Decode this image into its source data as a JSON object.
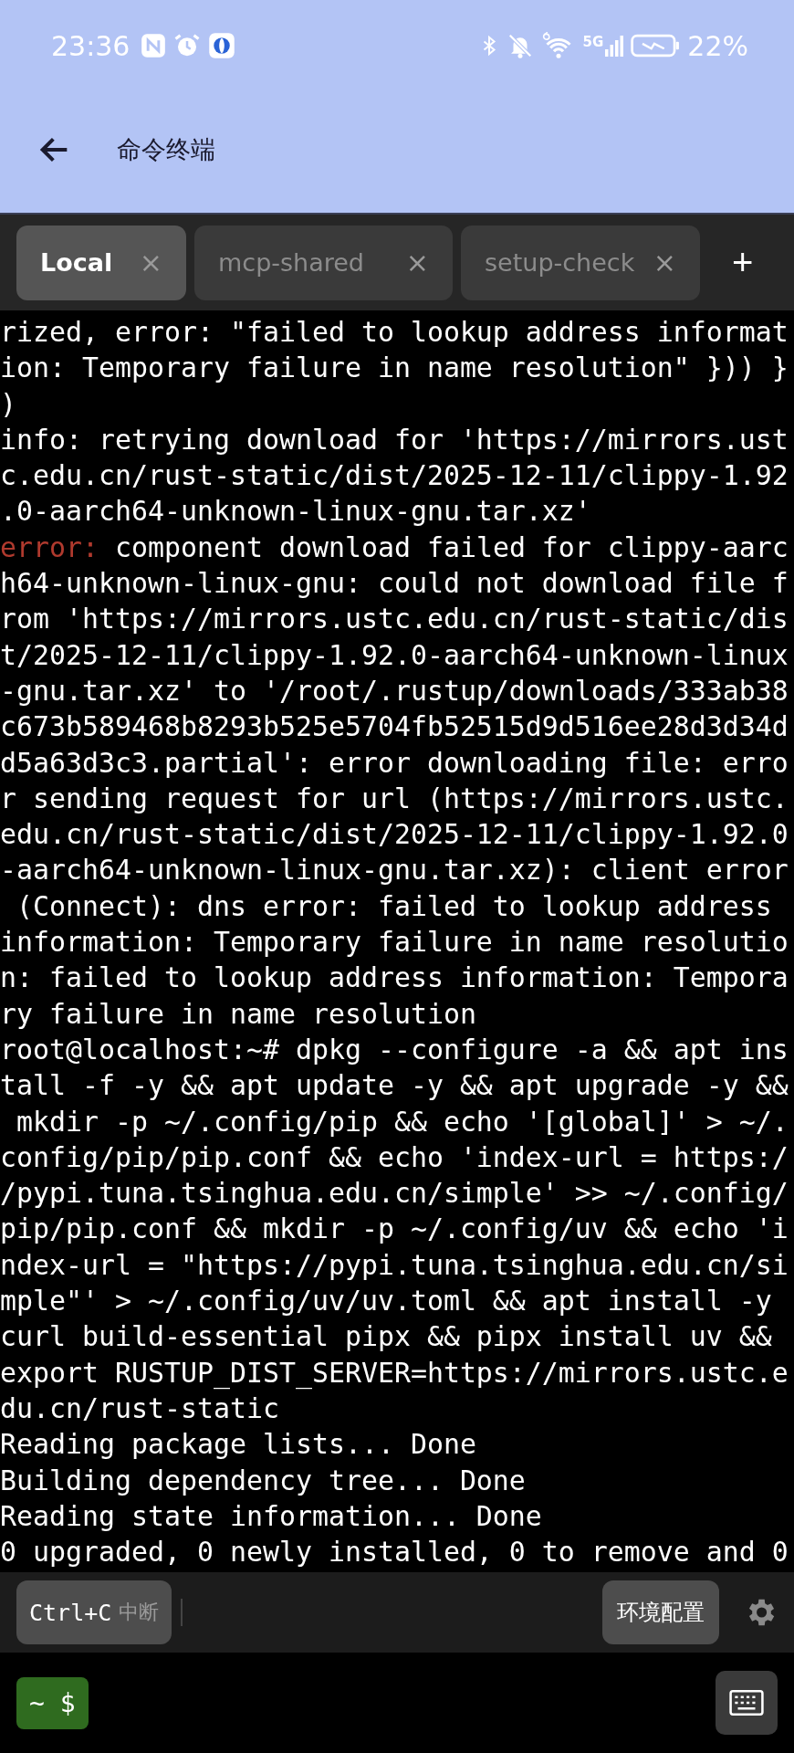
{
  "status_bar": {
    "time": "23:36",
    "network": "5G",
    "battery": "22%"
  },
  "app_bar": {
    "title": "命令终端"
  },
  "tabs": [
    {
      "label": "Local",
      "selected": true,
      "close": "×"
    },
    {
      "label": "mcp-shared",
      "selected": false,
      "close": "×"
    },
    {
      "label": "setup-check",
      "selected": false,
      "close": "×"
    }
  ],
  "new_tab": "+",
  "terminal": {
    "lines": [
      {
        "kind": "plain",
        "text": "rized, error: \"failed to lookup address informat"
      },
      {
        "kind": "plain",
        "text": "ion: Temporary failure in name resolution\" })) }"
      },
      {
        "kind": "plain",
        "text": ")"
      },
      {
        "kind": "plain",
        "text": "info: retrying download for 'https://mirrors.ust"
      },
      {
        "kind": "plain",
        "text": "c.edu.cn/rust-static/dist/2025-12-11/clippy-1.92"
      },
      {
        "kind": "plain",
        "text": ".0-aarch64-unknown-linux-gnu.tar.xz'"
      },
      {
        "kind": "error",
        "label": "error:",
        "text": " component download failed for clippy-aarc"
      },
      {
        "kind": "plain",
        "text": "h64-unknown-linux-gnu: could not download file f"
      },
      {
        "kind": "plain",
        "text": "rom 'https://mirrors.ustc.edu.cn/rust-static/dis"
      },
      {
        "kind": "plain",
        "text": "t/2025-12-11/clippy-1.92.0-aarch64-unknown-linux"
      },
      {
        "kind": "plain",
        "text": "-gnu.tar.xz' to '/root/.rustup/downloads/333ab38"
      },
      {
        "kind": "plain",
        "text": "c673b589468b8293b525e5704fb52515d9d516ee28d3d34d"
      },
      {
        "kind": "plain",
        "text": "d5a63d3c3.partial': error downloading file: erro"
      },
      {
        "kind": "plain",
        "text": "r sending request for url (https://mirrors.ustc."
      },
      {
        "kind": "plain",
        "text": "edu.cn/rust-static/dist/2025-12-11/clippy-1.92.0"
      },
      {
        "kind": "plain",
        "text": "-aarch64-unknown-linux-gnu.tar.xz): client error"
      },
      {
        "kind": "plain",
        "text": " (Connect): dns error: failed to lookup address"
      },
      {
        "kind": "plain",
        "text": "information: Temporary failure in name resolutio"
      },
      {
        "kind": "plain",
        "text": "n: failed to lookup address information: Tempora"
      },
      {
        "kind": "plain",
        "text": "ry failure in name resolution"
      },
      {
        "kind": "plain",
        "text": "root@localhost:~# dpkg --configure -a && apt ins"
      },
      {
        "kind": "plain",
        "text": "tall -f -y && apt update -y && apt upgrade -y &&"
      },
      {
        "kind": "plain",
        "text": " mkdir -p ~/.config/pip && echo '[global]' > ~/."
      },
      {
        "kind": "plain",
        "text": "config/pip/pip.conf && echo 'index-url = https:/"
      },
      {
        "kind": "plain",
        "text": "/pypi.tuna.tsinghua.edu.cn/simple' >> ~/.config/"
      },
      {
        "kind": "plain",
        "text": "pip/pip.conf && mkdir -p ~/.config/uv && echo 'i"
      },
      {
        "kind": "plain",
        "text": "ndex-url = \"https://pypi.tuna.tsinghua.edu.cn/si"
      },
      {
        "kind": "plain",
        "text": "mple\"' > ~/.config/uv/uv.toml && apt install -y"
      },
      {
        "kind": "plain",
        "text": "curl build-essential pipx && pipx install uv &&"
      },
      {
        "kind": "plain",
        "text": "export RUSTUP_DIST_SERVER=https://mirrors.ustc.e"
      },
      {
        "kind": "plain",
        "text": "du.cn/rust-static"
      },
      {
        "kind": "plain",
        "text": "Reading package lists... Done"
      },
      {
        "kind": "plain",
        "text": "Building dependency tree... Done"
      },
      {
        "kind": "plain",
        "text": "Reading state information... Done"
      },
      {
        "kind": "plain",
        "text": "0 upgraded, 0 newly installed, 0 to remove and 0"
      }
    ]
  },
  "toolbar": {
    "interrupt_key": "Ctrl+C",
    "interrupt_label": "中断",
    "env_button": "环境配置"
  },
  "prompt": {
    "label": "~ $"
  }
}
